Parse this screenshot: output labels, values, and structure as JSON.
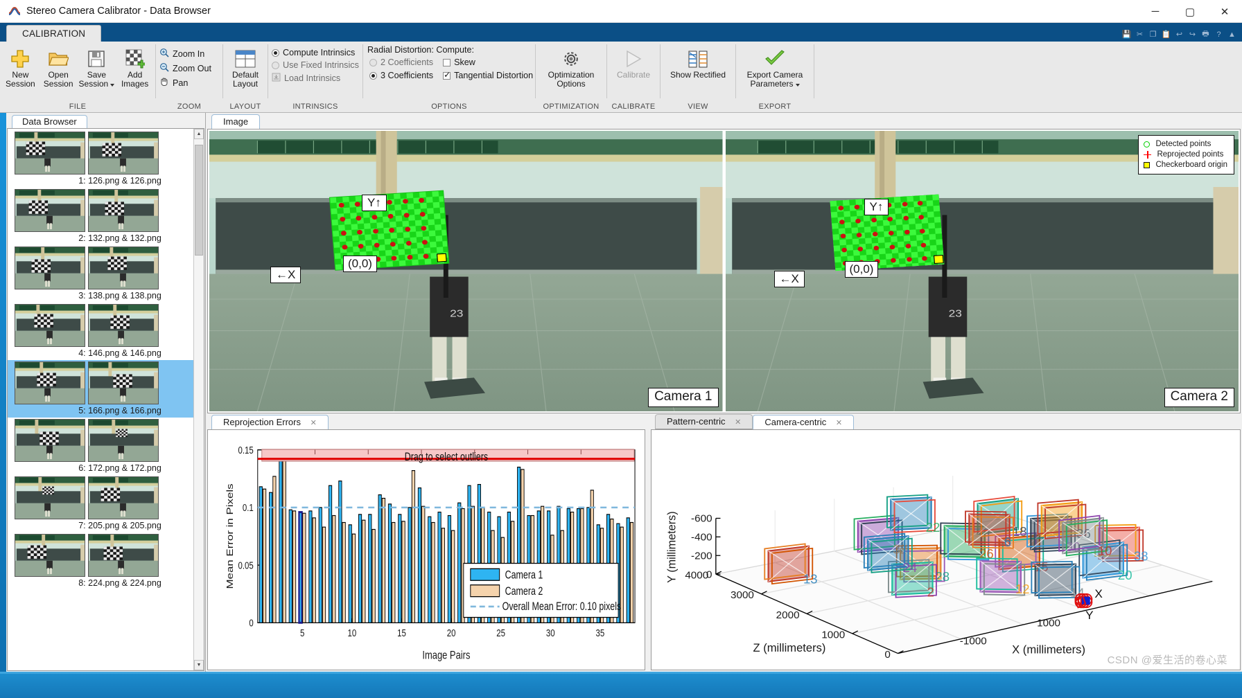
{
  "window": {
    "title": "Stereo Camera Calibrator - Data Browser",
    "minimize": "─",
    "maximize": "▢",
    "close": "✕"
  },
  "ribbon": {
    "tab": "CALIBRATION",
    "groups": {
      "file": {
        "name": "FILE",
        "buttons": [
          {
            "icon": "plus-icon",
            "line1": "New",
            "line2": "Session"
          },
          {
            "icon": "folder-icon",
            "line1": "Open",
            "line2": "Session"
          },
          {
            "icon": "save-icon",
            "line1": "Save",
            "line2": "Session",
            "caret": true
          },
          {
            "icon": "add-images-icon",
            "line1": "Add",
            "line2": "Images"
          }
        ]
      },
      "zoom": {
        "name": "ZOOM",
        "items": [
          {
            "icon": "zoom-in-icon",
            "label": "Zoom In"
          },
          {
            "icon": "zoom-out-icon",
            "label": "Zoom Out"
          },
          {
            "icon": "pan-hand-icon",
            "label": "Pan"
          }
        ]
      },
      "layout": {
        "name": "LAYOUT",
        "button": {
          "icon": "layout-icon",
          "line1": "Default",
          "line2": "Layout"
        }
      },
      "intrinsics": {
        "name": "INTRINSICS",
        "items": [
          {
            "type": "radio",
            "label": "Compute Intrinsics",
            "selected": true,
            "enabled": true
          },
          {
            "type": "radio",
            "label": "Use Fixed Intrinsics",
            "selected": false,
            "enabled": false
          },
          {
            "type": "icon",
            "label": "Load Intrinsics",
            "icon": "load-intrinsics-icon",
            "enabled": false
          }
        ]
      },
      "options": {
        "name": "OPTIONS",
        "title": "Radial Distortion: Compute:",
        "items": [
          {
            "type": "radio",
            "label": "2 Coefficients",
            "selected": false,
            "enabled": false
          },
          {
            "type": "check",
            "label": "Skew",
            "checked": false
          },
          {
            "type": "radio",
            "label": "3 Coefficients",
            "selected": true,
            "enabled": true
          },
          {
            "type": "check",
            "label": "Tangential Distortion",
            "checked": true
          }
        ]
      },
      "optimization": {
        "name": "OPTIMIZATION",
        "button": {
          "icon": "gear-icon",
          "line1": "Optimization",
          "line2": "Options"
        }
      },
      "calibrate": {
        "name": "CALIBRATE",
        "button": {
          "icon": "play-icon",
          "line1": "Calibrate",
          "line2": ""
        }
      },
      "view": {
        "name": "VIEW",
        "button": {
          "icon": "show-rectified-icon",
          "line1": "Show Rectified",
          "line2": ""
        }
      },
      "export": {
        "name": "EXPORT",
        "button": {
          "icon": "checkmark-icon",
          "line1": "Export Camera",
          "line2": "Parameters",
          "caret": true
        }
      }
    }
  },
  "browser": {
    "tab": "Data Browser",
    "selected_index": 4,
    "items": [
      {
        "label": "1: 126.png & 126.png"
      },
      {
        "label": "2: 132.png & 132.png"
      },
      {
        "label": "3: 138.png & 138.png"
      },
      {
        "label": "4: 146.png & 146.png"
      },
      {
        "label": "5: 166.png & 166.png"
      },
      {
        "label": "6: 172.png & 172.png"
      },
      {
        "label": "7: 205.png & 205.png"
      },
      {
        "label": "8: 224.png & 224.png"
      }
    ]
  },
  "image_panel": {
    "tab": "Image",
    "camera1_label": "Camera 1",
    "camera2_label": "Camera 2",
    "legend": [
      {
        "marker": "detected-points-marker",
        "label": "Detected points"
      },
      {
        "marker": "reprojected-points-marker",
        "label": "Reprojected points"
      },
      {
        "marker": "checkerboard-origin-marker",
        "label": "Checkerboard origin"
      }
    ],
    "annotations": {
      "y_axis": "Y↑",
      "x_axis": "←X",
      "origin": "(0,0)"
    }
  },
  "reprojection_panel": {
    "tab": "Reprojection Errors",
    "close_glyph": "✕"
  },
  "extrinsics_panel": {
    "tabs": [
      {
        "label": "Pattern-centric",
        "active": false
      },
      {
        "label": "Camera-centric",
        "active": true
      }
    ],
    "close_glyph": "✕"
  },
  "watermark": "CSDN @爱生活的卷心菜",
  "chart_data": [
    {
      "id": "reprojection-errors",
      "type": "bar",
      "title": "",
      "xlabel": "Image Pairs",
      "ylabel": "Mean Error in Pixels",
      "ylim": [
        0,
        0.15
      ],
      "yticks": [
        0,
        0.05,
        0.1,
        0.15
      ],
      "ytick_labels": [
        "0",
        "0.05",
        "0.1",
        "0.15"
      ],
      "xticks": [
        5,
        10,
        15,
        20,
        25,
        30,
        35
      ],
      "xtick_labels": [
        "5",
        "10",
        "15",
        "20",
        "25",
        "30",
        "35"
      ],
      "grid": false,
      "legend_position": "bottom-right",
      "slider_label": "Drag to select outliers",
      "slider_color": "#f7c8c8",
      "slider_line_color": "#e00000",
      "mean_line": {
        "value": 0.1,
        "label": "Overall Mean Error: 0.10 pixels",
        "color": "#7fb8dd",
        "dashed": true
      },
      "selected_pair": 5,
      "selected_color": "#1a1a8c",
      "categories": [
        1,
        2,
        3,
        4,
        5,
        6,
        7,
        8,
        9,
        10,
        11,
        12,
        13,
        14,
        15,
        16,
        17,
        18,
        19,
        20,
        21,
        22,
        23,
        24,
        25,
        26,
        27,
        28,
        29,
        30,
        31,
        32,
        33,
        34,
        35,
        36,
        37,
        38
      ],
      "series": [
        {
          "name": "Camera 1",
          "color": "#2eb4f2",
          "values": [
            0.118,
            0.113,
            0.145,
            0.098,
            0.096,
            0.097,
            0.1,
            0.119,
            0.123,
            0.085,
            0.094,
            0.094,
            0.111,
            0.103,
            0.094,
            0.1,
            0.117,
            0.092,
            0.096,
            0.093,
            0.104,
            0.119,
            0.12,
            0.096,
            0.092,
            0.096,
            0.135,
            0.093,
            0.097,
            0.097,
            0.101,
            0.099,
            0.099,
            0.1,
            0.085,
            0.094,
            0.086,
            0.091
          ]
        },
        {
          "name": "Camera 2",
          "color": "#f5d3ac",
          "values": [
            0.116,
            0.127,
            0.141,
            0.097,
            0.095,
            0.091,
            0.083,
            0.093,
            0.087,
            0.077,
            0.089,
            0.081,
            0.108,
            0.087,
            0.088,
            0.132,
            0.101,
            0.087,
            0.082,
            0.08,
            0.099,
            0.101,
            0.1,
            0.08,
            0.074,
            0.088,
            0.133,
            0.093,
            0.101,
            0.076,
            0.08,
            0.096,
            0.099,
            0.115,
            0.082,
            0.09,
            0.083,
            0.087
          ]
        }
      ]
    },
    {
      "id": "camera-centric-extrinsics",
      "type": "scatter3d",
      "xlabel": "X (millimeters)",
      "ylabel": "Y (millimeters)",
      "zlabel": "Z (millimeters)",
      "y_ticks": [
        "-600",
        "-400",
        "-200",
        "0"
      ],
      "z_ticks": [
        "4000",
        "3000",
        "2000",
        "1000",
        "0"
      ],
      "x_ticks": [
        "1000",
        "-1000"
      ],
      "pattern_labels": [
        "13",
        "32",
        "22",
        "28",
        "26",
        "18",
        "15",
        "30",
        "38",
        "12",
        "20",
        "36",
        "2",
        "14",
        "6",
        "10",
        "24"
      ],
      "camera_marker": {
        "label": "X",
        "color": "#e01010"
      },
      "camera_marker2": {
        "label": "Y",
        "color": "#1020d0"
      }
    }
  ]
}
